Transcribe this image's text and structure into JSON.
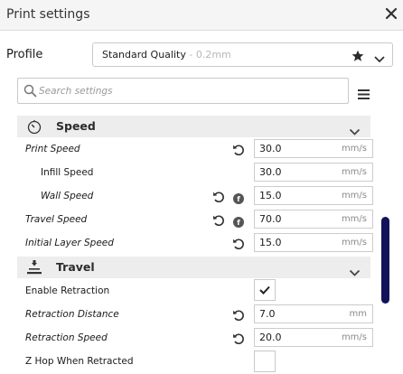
{
  "window": {
    "title": "Print settings"
  },
  "profile": {
    "label": "Profile",
    "value": "Standard Quality",
    "sub": " - 0.2mm"
  },
  "search": {
    "placeholder": "Search settings"
  },
  "categories": {
    "speed": {
      "label": "Speed"
    },
    "travel": {
      "label": "Travel"
    }
  },
  "settings": {
    "print_speed": {
      "label": "Print Speed",
      "value": "30.0",
      "unit": "mm/s"
    },
    "infill_speed": {
      "label": "Infill Speed",
      "value": "30.0",
      "unit": "mm/s"
    },
    "wall_speed": {
      "label": "Wall Speed",
      "value": "15.0",
      "unit": "mm/s"
    },
    "travel_speed": {
      "label": "Travel Speed",
      "value": "70.0",
      "unit": "mm/s"
    },
    "initial_layer_speed": {
      "label": "Initial Layer Speed",
      "value": "15.0",
      "unit": "mm/s"
    },
    "enable_retraction": {
      "label": "Enable Retraction",
      "checked": true
    },
    "retraction_distance": {
      "label": "Retraction Distance",
      "value": "7.0",
      "unit": "mm"
    },
    "retraction_speed": {
      "label": "Retraction Speed",
      "value": "20.0",
      "unit": "mm/s"
    },
    "z_hop": {
      "label": "Z Hop When Retracted",
      "checked": false
    }
  },
  "colors": {
    "scrollbar": "#12125a",
    "category_bg": "#ededed"
  }
}
